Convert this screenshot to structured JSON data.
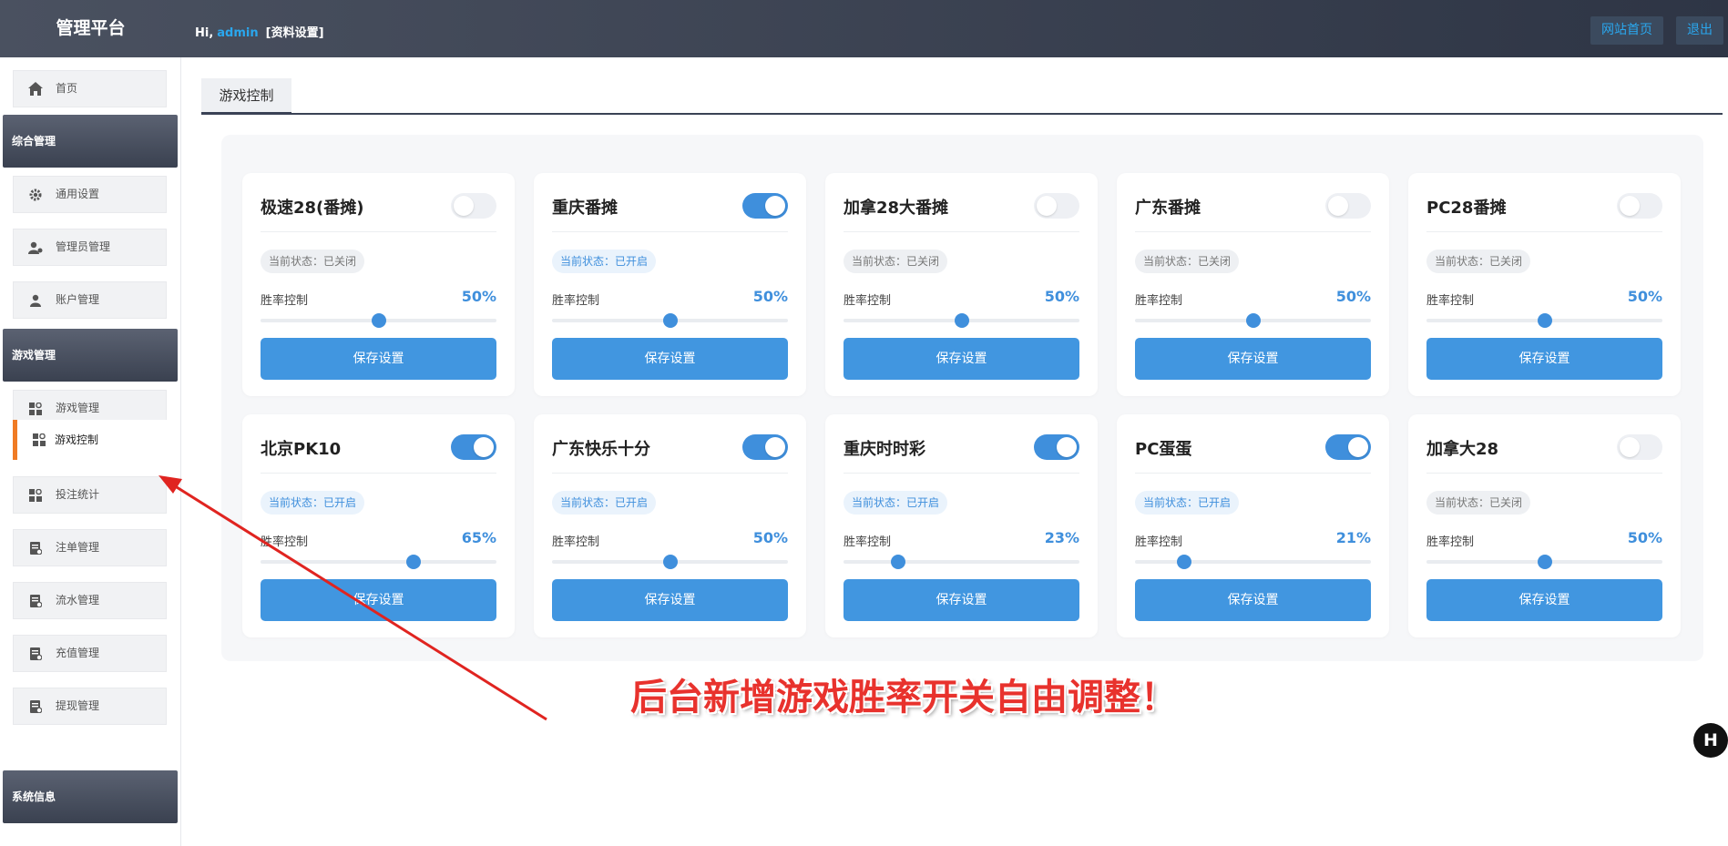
{
  "header": {
    "logo": "管理平台",
    "greeting": "Hi,",
    "username": "admin",
    "profile_link": "[资料设置]",
    "home_button": "网站首页",
    "logout_button": "退出"
  },
  "sidebar": {
    "home": "首页",
    "groups": [
      {
        "label": "综合管理"
      },
      {
        "label": "游戏管理"
      },
      {
        "label": "系统信息"
      }
    ],
    "items": [
      {
        "label": "通用设置",
        "icon": "gear-icon"
      },
      {
        "label": "管理员管理",
        "icon": "user-group-icon"
      },
      {
        "label": "账户管理",
        "icon": "user-icon"
      },
      {
        "label": "游戏管理",
        "icon": "grid-icon"
      },
      {
        "label": "游戏控制",
        "icon": "grid-icon",
        "active": true
      },
      {
        "label": "投注统计",
        "icon": "grid-icon"
      },
      {
        "label": "注单管理",
        "icon": "doc-icon"
      },
      {
        "label": "流水管理",
        "icon": "doc-icon"
      },
      {
        "label": "充值管理",
        "icon": "doc-icon"
      },
      {
        "label": "提现管理",
        "icon": "doc-icon"
      }
    ]
  },
  "tab": {
    "label": "游戏控制"
  },
  "cards": [
    {
      "title": "极速28(番摊)",
      "enabled": false,
      "status": "当前状态：已关闭",
      "win_label": "胜率控制",
      "win_rate": "50%",
      "save": "保存设置"
    },
    {
      "title": "重庆番摊",
      "enabled": true,
      "status": "当前状态：已开启",
      "win_label": "胜率控制",
      "win_rate": "50%",
      "save": "保存设置"
    },
    {
      "title": "加拿28大番摊",
      "enabled": false,
      "status": "当前状态：已关闭",
      "win_label": "胜率控制",
      "win_rate": "50%",
      "save": "保存设置"
    },
    {
      "title": "广东番摊",
      "enabled": false,
      "status": "当前状态：已关闭",
      "win_label": "胜率控制",
      "win_rate": "50%",
      "save": "保存设置"
    },
    {
      "title": "PC28番摊",
      "enabled": false,
      "status": "当前状态：已关闭",
      "win_label": "胜率控制",
      "win_rate": "50%",
      "save": "保存设置"
    },
    {
      "title": "北京PK10",
      "enabled": true,
      "status": "当前状态：已开启",
      "win_label": "胜率控制",
      "win_rate": "65%",
      "save": "保存设置"
    },
    {
      "title": "广东快乐十分",
      "enabled": true,
      "status": "当前状态：已开启",
      "win_label": "胜率控制",
      "win_rate": "50%",
      "save": "保存设置"
    },
    {
      "title": "重庆时时彩",
      "enabled": true,
      "status": "当前状态：已开启",
      "win_label": "胜率控制",
      "win_rate": "23%",
      "save": "保存设置"
    },
    {
      "title": "PC蛋蛋",
      "enabled": true,
      "status": "当前状态：已开启",
      "win_label": "胜率控制",
      "win_rate": "21%",
      "save": "保存设置"
    },
    {
      "title": "加拿大28",
      "enabled": false,
      "status": "当前状态：已关闭",
      "win_label": "胜率控制",
      "win_rate": "50%",
      "save": "保存设置"
    }
  ],
  "annotation": "后台新增游戏胜率开关自由调整！",
  "corner_logo": "H",
  "colors": {
    "accent": "#3f8fdc",
    "active_marker": "#f07b24",
    "annotation": "#e8322d"
  }
}
